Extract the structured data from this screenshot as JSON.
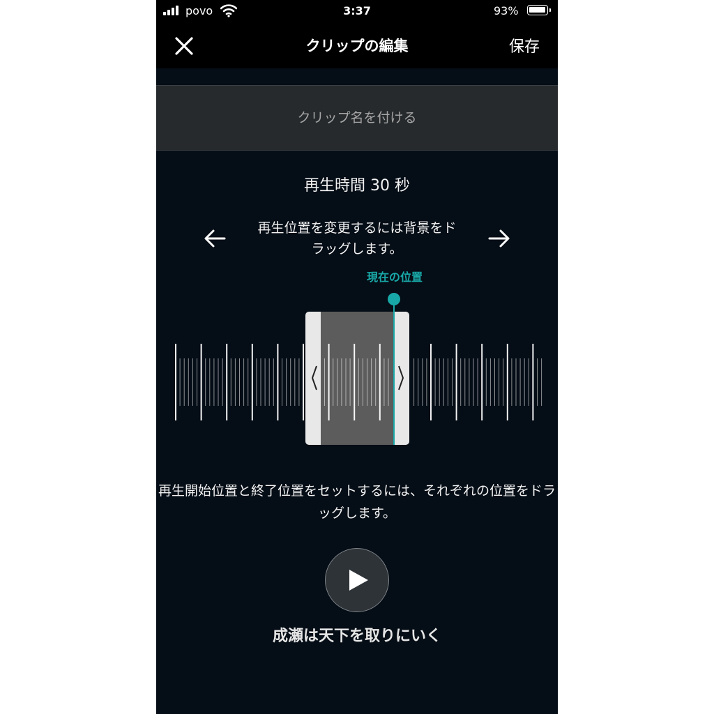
{
  "status_bar": {
    "carrier": "povo",
    "time": "3:37",
    "battery": "93%",
    "battery_level": 0.93
  },
  "nav": {
    "title": "クリップの編集",
    "save_label": "保存",
    "close_icon": "close-icon"
  },
  "name_field": {
    "placeholder": "クリップ名を付ける",
    "value": ""
  },
  "duration_text": "再生時間 30 秒",
  "hint_top": "再生位置を変更するには背景をドラッグします。",
  "current_position_label": "現在の位置",
  "hint_bottom": "再生開始位置と終了位置をセットするには、それぞれの位置をドラッグします。",
  "clip_title": "成瀬は天下を取りにいく",
  "colors": {
    "accent": "#19a8a8",
    "background": "#050d16",
    "bar": "#000000",
    "field": "#262a2d"
  }
}
